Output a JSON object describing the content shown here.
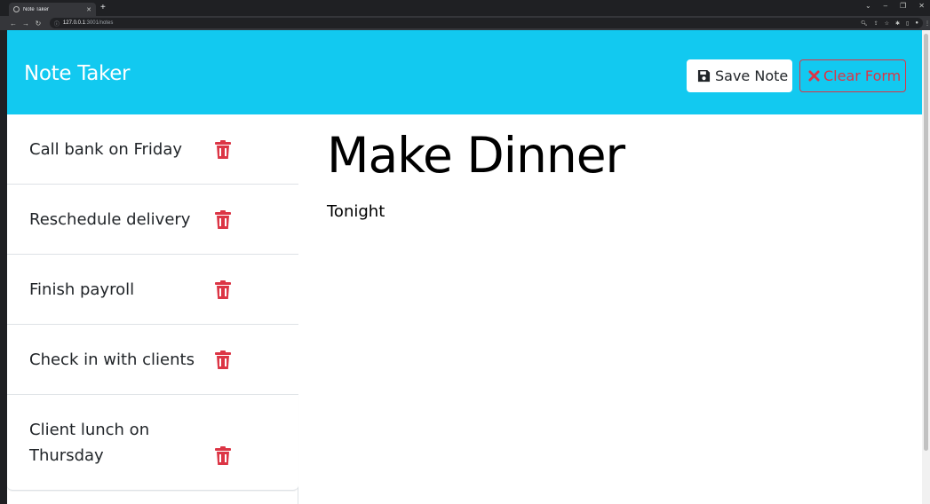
{
  "browser": {
    "tab_title": "Note Taker",
    "url_host": "127.0.0.1",
    "url_rest": ":3001/notes"
  },
  "navbar": {
    "brand": "Note Taker",
    "save_label": "Save Note",
    "clear_label": "Clear Form"
  },
  "notes": [
    {
      "title": "Call bank on Friday"
    },
    {
      "title": "Reschedule delivery"
    },
    {
      "title": "Finish payroll"
    },
    {
      "title": "Check in with clients"
    },
    {
      "title": "Client lunch on Thursday"
    }
  ],
  "active_note": {
    "title": "Make Dinner",
    "text": "Tonight"
  },
  "colors": {
    "navbar": "#12c9f0",
    "danger": "#dc3545"
  }
}
